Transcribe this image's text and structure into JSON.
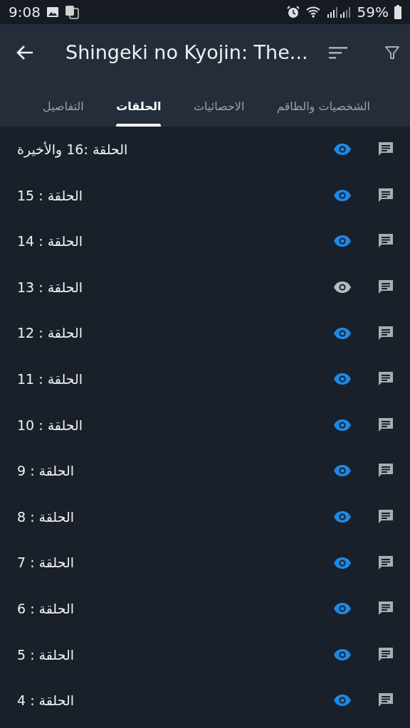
{
  "status_bar": {
    "time": "9:08",
    "battery": "59%"
  },
  "app_bar": {
    "title": "Shingeki no Kyojin: The..."
  },
  "tabs": [
    {
      "label": "الشخصيات والطاقم",
      "selected": false
    },
    {
      "label": "الاحصائيات",
      "selected": false
    },
    {
      "label": "الحلقات",
      "selected": true
    },
    {
      "label": "التفاصيل",
      "selected": false
    }
  ],
  "episodes": [
    {
      "title": "الحلقة :16 والأخيرة",
      "watched": true
    },
    {
      "title": "الحلقة : 15",
      "watched": true
    },
    {
      "title": "الحلقة : 14",
      "watched": true
    },
    {
      "title": "الحلقة : 13",
      "watched": false
    },
    {
      "title": "الحلقة : 12",
      "watched": true
    },
    {
      "title": "الحلقة : 11",
      "watched": true
    },
    {
      "title": "الحلقة : 10",
      "watched": true
    },
    {
      "title": "الحلقة : 9",
      "watched": true
    },
    {
      "title": "الحلقة : 8",
      "watched": true
    },
    {
      "title": "الحلقة : 7",
      "watched": true
    },
    {
      "title": "الحلقة : 6",
      "watched": true
    },
    {
      "title": "الحلقة : 5",
      "watched": true
    },
    {
      "title": "الحلقة : 4",
      "watched": true
    }
  ]
}
